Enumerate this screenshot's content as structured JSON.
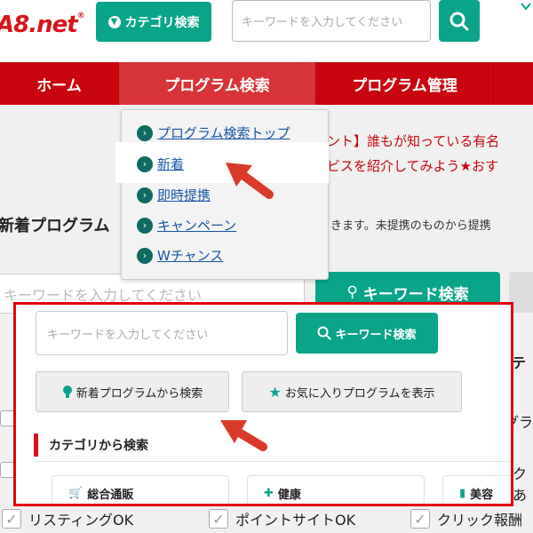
{
  "header": {
    "logo": "A8.net",
    "logo_mark": "®",
    "category_button": "カテゴリ検索",
    "search_placeholder": "キーワードを入力してください"
  },
  "nav": {
    "items": [
      {
        "label": "ホーム"
      },
      {
        "label": "プログラム検索"
      },
      {
        "label": "プログラム管理"
      }
    ]
  },
  "dropdown": {
    "items": [
      {
        "label": "プログラム検索トップ"
      },
      {
        "label": "新着"
      },
      {
        "label": "即時提携"
      },
      {
        "label": "キャンペーン"
      },
      {
        "label": "Wチャンス"
      }
    ]
  },
  "background": {
    "notice_line1": "ント】誰もが知っている有名",
    "notice_line2": "ビスを紹介してみよう★おす",
    "heading": "新着プログラム",
    "description": "きます。未提携のものから提携",
    "input_placeholder": "キーワードを入力してください",
    "keyword_button": "キーワード検索",
    "right_heading": "テ",
    "right_text1": "グラ",
    "right_text2": "クあ",
    "checks": [
      {
        "label": "リスティングOK"
      },
      {
        "label": "ポイントサイトOK"
      },
      {
        "label": "クリック報酬"
      }
    ]
  },
  "panel": {
    "input_placeholder": "キーワードを入力してください",
    "keyword_button": "キーワード検索",
    "new_button": "新着プログラムから検索",
    "fav_button": "お気に入りプログラムを表示",
    "section_title": "カテゴリから検索",
    "categories": [
      {
        "label": "総合通販",
        "icon": "cart-icon"
      },
      {
        "label": "健康",
        "icon": "medkit-icon"
      },
      {
        "label": "美容",
        "icon": "lipstick-icon"
      }
    ]
  },
  "colors": {
    "brand_red": "#c9060f",
    "accent_green": "#0aa489",
    "highlight_border": "#e0000b"
  }
}
